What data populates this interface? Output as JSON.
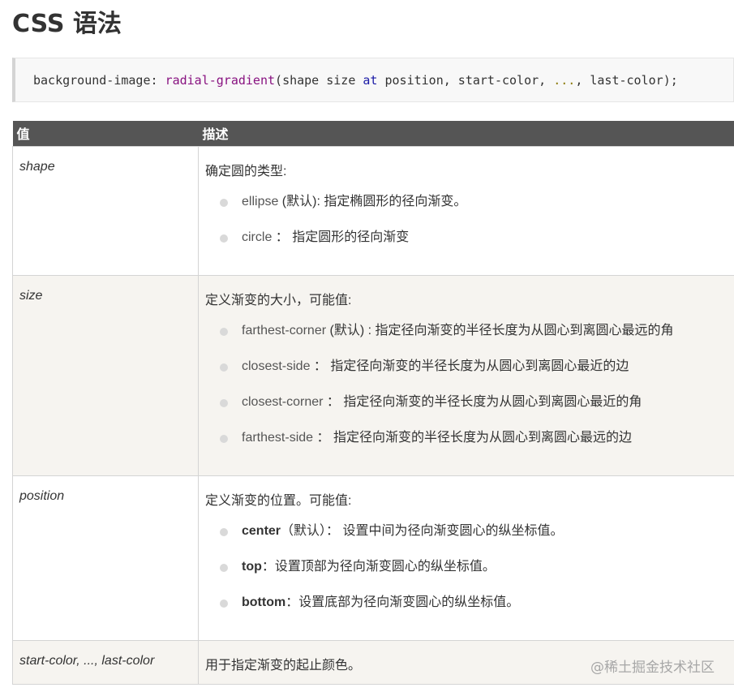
{
  "page": {
    "title": "CSS 语法"
  },
  "code": {
    "prop": "background-image: ",
    "fn": "radial-gradient",
    "open": "(",
    "shape": "shape",
    "size": " size ",
    "at": "at",
    "position": " position, start-color, ",
    "dots": "...",
    "sep": ", ",
    "last": "last-color",
    "close": ");"
  },
  "table": {
    "headers": [
      "值",
      "描述"
    ],
    "rows": [
      {
        "name": "shape",
        "desc": "确定圆的类型:",
        "items": [
          {
            "opt": "ellipse",
            "text": " (默认): 指定椭圆形的径向渐变。"
          },
          {
            "opt": "circle",
            "text": " ： 指定圆形的径向渐变"
          }
        ]
      },
      {
        "name": "size",
        "desc": "定义渐变的大小，可能值:",
        "items": [
          {
            "opt": "farthest-corner",
            "text": " (默认) : 指定径向渐变的半径长度为从圆心到离圆心最远的角"
          },
          {
            "opt": "closest-side",
            "text": " ： 指定径向渐变的半径长度为从圆心到离圆心最近的边"
          },
          {
            "opt": "closest-corner",
            "text": " ：  指定径向渐变的半径长度为从圆心到离圆心最近的角"
          },
          {
            "opt": "farthest-side",
            "text": " ： 指定径向渐变的半径长度为从圆心到离圆心最远的边"
          }
        ]
      },
      {
        "name": "position",
        "desc": "定义渐变的位置。可能值:",
        "items": [
          {
            "opt": "center",
            "text": "（默认）： 设置中间为径向渐变圆心的纵坐标值。"
          },
          {
            "opt": "top",
            "text": "：设置顶部为径向渐变圆心的纵坐标值。"
          },
          {
            "opt": "bottom",
            "text": "：设置底部为径向渐变圆心的纵坐标值。"
          }
        ]
      },
      {
        "name": "start-color, ..., last-color",
        "desc": "用于指定渐变的起止颜色。"
      }
    ]
  },
  "watermark": "@稀土掘金技术社区"
}
